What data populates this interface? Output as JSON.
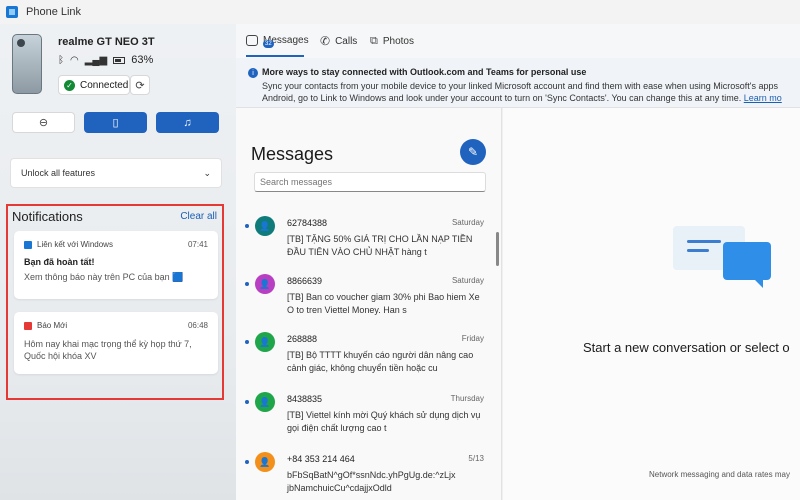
{
  "app": {
    "title": "Phone Link"
  },
  "device": {
    "name": "realme GT NEO 3T",
    "battery": "63%",
    "status": "Connected"
  },
  "unlock": {
    "label": "Unlock all features"
  },
  "notifications": {
    "title": "Notifications",
    "clear_label": "Clear all",
    "items": [
      {
        "source": "Liên kết với Windows",
        "time": "07:41",
        "head": "Bạn đã hoàn tất!",
        "body": "Xem thông báo này trên PC của bạn 🟦"
      },
      {
        "source": "Báo Mới",
        "time": "06:48",
        "head": "",
        "body": "Hôm nay khai mạc trọng thể kỳ họp thứ 7, Quốc hội khóa XV"
      }
    ]
  },
  "tabs": {
    "messages": "Messages",
    "messages_badge": "32",
    "calls": "Calls",
    "photos": "Photos"
  },
  "banner": {
    "title": "More ways to stay connected with Outlook.com and Teams for personal use",
    "line1": "Sync your contacts from your mobile device to your linked Microsoft account and find them with ease when using Microsoft's apps",
    "line2": "Android, go to Link to Windows and look under your account to turn on 'Sync Contacts'. You can change this at any time.",
    "link": "Learn mo"
  },
  "messages": {
    "title": "Messages",
    "search_placeholder": "Search messages",
    "conversations": [
      {
        "number": "62784388",
        "date": "Saturday",
        "preview": "[TB] TẶNG 50% GIÁ TRỊ CHO LẦN NẠP TIỀN ĐẦU TIÊN VÀO CHỦ NHẬT hàng t",
        "color": "#0f7b7b"
      },
      {
        "number": "8866639",
        "date": "Saturday",
        "preview": "[TB] Ban co voucher giam 30% phi Bao hiem Xe O to tren Viettel Money. Han s",
        "color": "#b83ec2"
      },
      {
        "number": "268888",
        "date": "Friday",
        "preview": "[TB] Bộ TTTT khuyến cáo người dân nâng cao cảnh giác, không chuyển tiền hoặc cu",
        "color": "#1fa54a"
      },
      {
        "number": "8438835",
        "date": "Thursday",
        "preview": "[TB] Viettel kính mời Quý khách sử dụng dịch vụ gọi điện chất lượng cao t",
        "color": "#1fa54a"
      },
      {
        "number": "+84 353 214 464",
        "date": "5/13",
        "preview": "bFbSqBatN^gOf*ssnNdc.yhPgUg.de:^zLjx jbNamchuicCu^cdajjxOdld",
        "color": "#f2901b"
      }
    ]
  },
  "conversation": {
    "empty_title": "Start a new conversation or select o",
    "rates_note": "Network messaging and data rates may"
  }
}
